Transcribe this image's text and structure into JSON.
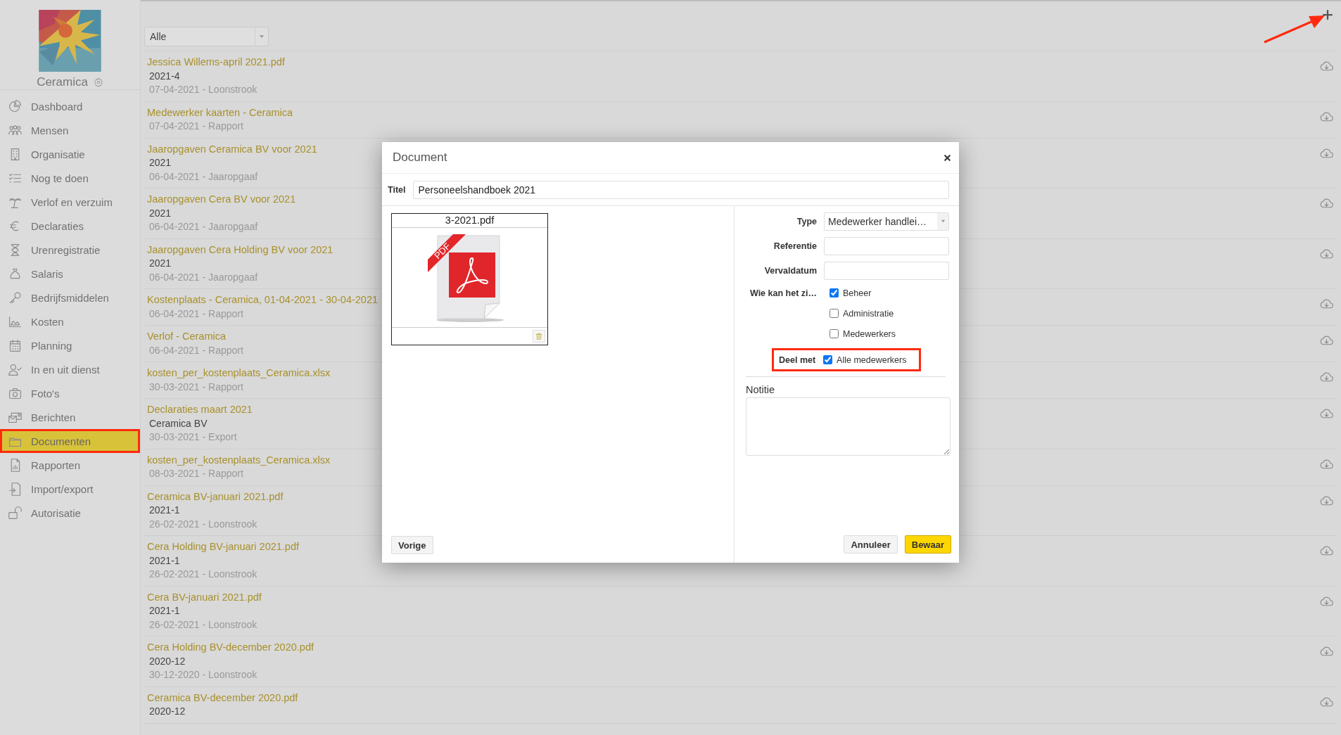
{
  "sidebar": {
    "company": "Ceramica",
    "items": [
      {
        "label": "Dashboard",
        "selected": false
      },
      {
        "label": "Mensen",
        "selected": false
      },
      {
        "label": "Organisatie",
        "selected": false
      },
      {
        "label": "Nog te doen",
        "selected": false
      },
      {
        "label": "Verlof en verzuim",
        "selected": false
      },
      {
        "label": "Declaraties",
        "selected": false
      },
      {
        "label": "Urenregistratie",
        "selected": false
      },
      {
        "label": "Salaris",
        "selected": false
      },
      {
        "label": "Bedrijfsmiddelen",
        "selected": false
      },
      {
        "label": "Kosten",
        "selected": false
      },
      {
        "label": "Planning",
        "selected": false
      },
      {
        "label": "In en uit dienst",
        "selected": false
      },
      {
        "label": "Foto's",
        "selected": false
      },
      {
        "label": "Berichten",
        "selected": false
      },
      {
        "label": "Documenten",
        "selected": true
      },
      {
        "label": "Rapporten",
        "selected": false
      },
      {
        "label": "Import/export",
        "selected": false
      },
      {
        "label": "Autorisatie",
        "selected": false
      }
    ]
  },
  "filter": {
    "value": "Alle"
  },
  "documents": [
    {
      "title": "Jessica Willems-april 2021.pdf",
      "subtitle": "2021-4",
      "meta": "07-04-2021 - Loonstrook"
    },
    {
      "title": "Medewerker kaarten - Ceramica",
      "meta": "07-04-2021 - Rapport"
    },
    {
      "title": "Jaaropgaven Ceramica BV voor 2021",
      "subtitle": "2021",
      "meta": "06-04-2021 - Jaaropgaaf"
    },
    {
      "title": "Jaaropgaven Cera BV voor 2021",
      "subtitle": "2021",
      "meta": "06-04-2021 - Jaaropgaaf"
    },
    {
      "title": "Jaaropgaven Cera Holding BV voor 2021",
      "subtitle": "2021",
      "meta": "06-04-2021 - Jaaropgaaf"
    },
    {
      "title": "Kostenplaats - Ceramica, 01-04-2021 - 30-04-2021",
      "meta": "06-04-2021 - Rapport"
    },
    {
      "title": "Verlof - Ceramica",
      "meta": "06-04-2021 - Rapport"
    },
    {
      "title": "kosten_per_kostenplaats_Ceramica.xlsx",
      "meta": "30-03-2021 - Rapport"
    },
    {
      "title": "Declaraties maart 2021",
      "subtitle": "Ceramica BV",
      "meta": "30-03-2021 - Export"
    },
    {
      "title": "kosten_per_kostenplaats_Ceramica.xlsx",
      "meta": "08-03-2021 - Rapport"
    },
    {
      "title": "Ceramica BV-januari 2021.pdf",
      "subtitle": "2021-1",
      "meta": "26-02-2021 - Loonstrook"
    },
    {
      "title": "Cera Holding BV-januari 2021.pdf",
      "subtitle": "2021-1",
      "meta": "26-02-2021 - Loonstrook"
    },
    {
      "title": "Cera BV-januari 2021.pdf",
      "subtitle": "2021-1",
      "meta": "26-02-2021 - Loonstrook"
    },
    {
      "title": "Cera Holding BV-december 2020.pdf",
      "subtitle": "2020-12",
      "meta": "30-12-2020 - Loonstrook"
    },
    {
      "title": "Ceramica BV-december 2020.pdf",
      "subtitle": "2020-12"
    }
  ],
  "dialog": {
    "title": "Document",
    "title_field": {
      "label": "Titel",
      "value": "Personeelshandboek 2021"
    },
    "file": {
      "name": "3-2021.pdf",
      "badge": "PDF"
    },
    "type": {
      "label": "Type",
      "value": "Medewerker handlei…"
    },
    "reference": {
      "label": "Referentie"
    },
    "expiry": {
      "label": "Vervaldatum"
    },
    "visibility": {
      "label": "Wie kan het zi…",
      "options": [
        {
          "label": "Beheer",
          "checked": true
        },
        {
          "label": "Administratie",
          "checked": false
        },
        {
          "label": "Medewerkers",
          "checked": false
        }
      ]
    },
    "share": {
      "label": "Deel met",
      "option": {
        "label": "Alle medewerkers",
        "checked": true
      }
    },
    "note": {
      "label": "Notitie"
    },
    "buttons": {
      "previous": "Vorige",
      "cancel": "Annuleer",
      "save": "Bewaar"
    }
  }
}
